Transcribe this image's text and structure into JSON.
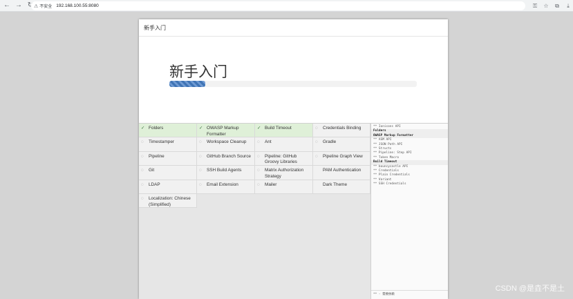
{
  "browser": {
    "back": "←",
    "forward": "→",
    "reload": "↻",
    "insecure_label": "不安全",
    "url": "192.168.100.55:8080"
  },
  "dialog": {
    "header_title": "新手入门",
    "hero_title": "新手入门",
    "progress_fraction": 0.145
  },
  "plugins": [
    {
      "label": "Folders",
      "status": "done"
    },
    {
      "label": "OWASP Markup Formatter",
      "status": "done"
    },
    {
      "label": "Build Timeout",
      "status": "done"
    },
    {
      "label": "Credentials Binding",
      "status": "pending"
    },
    {
      "label": "Timestamper",
      "status": "pending"
    },
    {
      "label": "Workspace Cleanup",
      "status": "pending"
    },
    {
      "label": "Ant",
      "status": "pending"
    },
    {
      "label": "Gradle",
      "status": "pending"
    },
    {
      "label": "Pipeline",
      "status": "pending"
    },
    {
      "label": "GitHub Branch Source",
      "status": "pending"
    },
    {
      "label": "Pipeline: GitHub Groovy Libraries",
      "status": "pending"
    },
    {
      "label": "Pipeline Graph View",
      "status": "pending"
    },
    {
      "label": "Git",
      "status": "pending"
    },
    {
      "label": "SSH Build Agents",
      "status": "pending"
    },
    {
      "label": "Matrix Authorization Strategy",
      "status": "pending"
    },
    {
      "label": "PAM Authentication",
      "status": "none"
    },
    {
      "label": "LDAP",
      "status": "pending"
    },
    {
      "label": "Email Extension",
      "status": "pending"
    },
    {
      "label": "Mailer",
      "status": "pending"
    },
    {
      "label": "Dark Theme",
      "status": "none"
    },
    {
      "label": "Localization: Chinese (Simplified)",
      "status": "pending"
    }
  ],
  "log": [
    {
      "text": "** Ionicons API",
      "header": false
    },
    {
      "text": "Folders",
      "header": true
    },
    {
      "text": "OWASP Markup Formatter",
      "header": true
    },
    {
      "text": "** ASM API",
      "header": false
    },
    {
      "text": "** JSON Path API",
      "header": false
    },
    {
      "text": "** Structs",
      "header": false
    },
    {
      "text": "** Pipeline: Step API",
      "header": false
    },
    {
      "text": "** Token Macro",
      "header": false
    },
    {
      "text": "Build Timeout",
      "header": true
    },
    {
      "text": "** bouncycastle API",
      "header": false
    },
    {
      "text": "** Credentials",
      "header": false
    },
    {
      "text": "** Plain Credentials",
      "header": false
    },
    {
      "text": "** Variant",
      "header": false
    },
    {
      "text": "** SSH Credentials",
      "header": false
    }
  ],
  "log_footer": "** - 需要依赖",
  "watermark": "CSDN @是垚不是土",
  "status_icons": {
    "done": "✓",
    "pending": "◌",
    "none": ""
  }
}
